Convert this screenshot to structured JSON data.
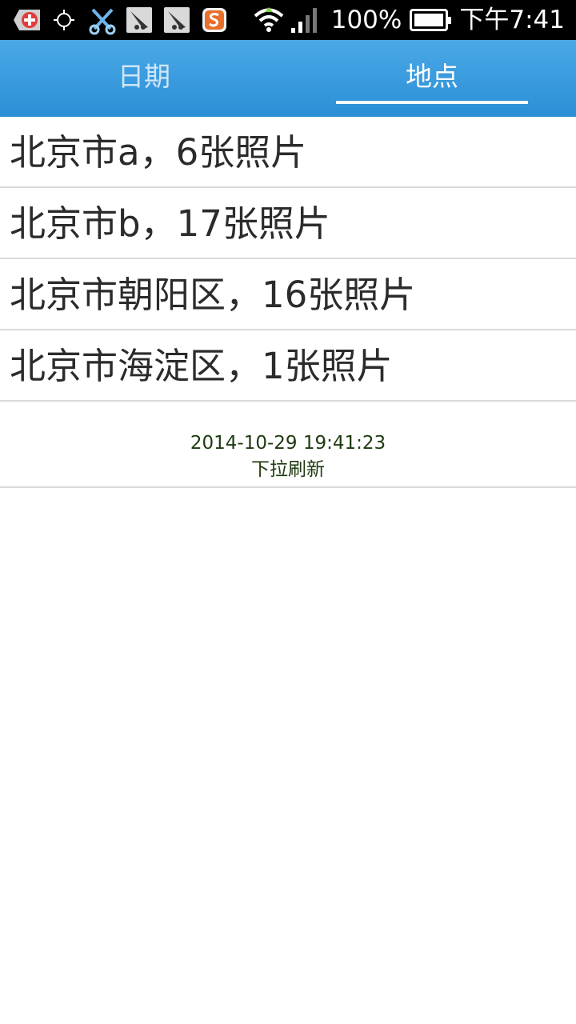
{
  "status_bar": {
    "icons": [
      "add-icon",
      "gps-icon",
      "scissors-icon",
      "app-icon",
      "app-icon",
      "sogou-icon"
    ],
    "battery_text": "100%",
    "battery_level": 1.0,
    "time": "下午7:41"
  },
  "tabs": [
    {
      "label": "日期",
      "selected": false
    },
    {
      "label": "地点",
      "selected": true
    }
  ],
  "list": {
    "items": [
      {
        "text": "北京市a，6张照片"
      },
      {
        "text": "北京市b，17张照片"
      },
      {
        "text": "北京市朝阳区，16张照片"
      },
      {
        "text": "北京市海淀区，1张照片"
      }
    ]
  },
  "refresh": {
    "timestamp": "2014-10-29 19:41:23",
    "label": "下拉刷新"
  },
  "colors": {
    "tab_bar": "#3a9ee0",
    "tab_selected": "#ffffff",
    "tab_unselected": "#cfe6f7",
    "refresh_text": "#1f3a10"
  }
}
